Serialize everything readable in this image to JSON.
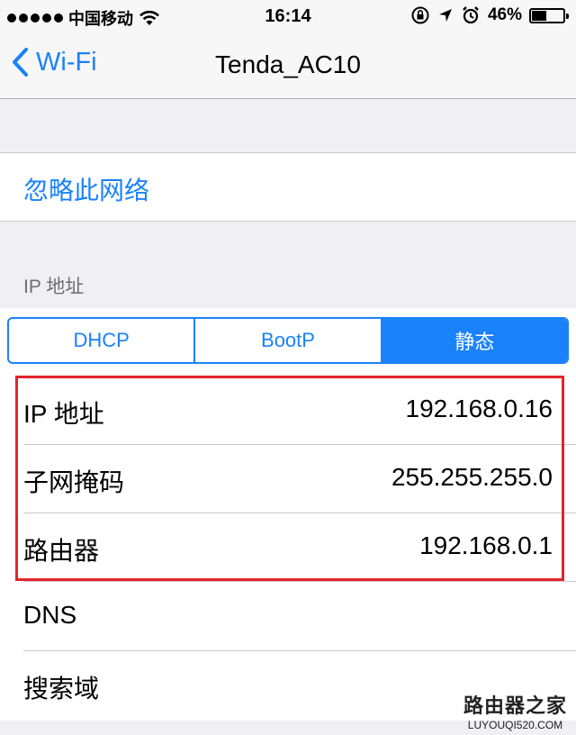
{
  "status_bar": {
    "carrier": "中国移动",
    "time": "16:14",
    "battery_percent": "46%",
    "battery_level": 0.46
  },
  "nav": {
    "back_label": "Wi-Fi",
    "title": "Tenda_AC10"
  },
  "forget_network": "忽略此网络",
  "ip_section": {
    "header": "IP 地址",
    "segments": [
      {
        "label": "DHCP",
        "selected": false
      },
      {
        "label": "BootP",
        "selected": false
      },
      {
        "label": "静态",
        "selected": true
      }
    ],
    "rows": [
      {
        "label": "IP 地址",
        "value": "192.168.0.16"
      },
      {
        "label": "子网掩码",
        "value": "255.255.255.0"
      },
      {
        "label": "路由器",
        "value": "192.168.0.1"
      },
      {
        "label": "DNS",
        "value": ""
      },
      {
        "label": "搜索域",
        "value": ""
      }
    ]
  },
  "watermark": {
    "title": "路由器之家",
    "url": "LUYOUQI520.COM"
  },
  "colors": {
    "accent": "#1a82fb",
    "highlight": "#e3242b",
    "background": "#efeff4"
  }
}
